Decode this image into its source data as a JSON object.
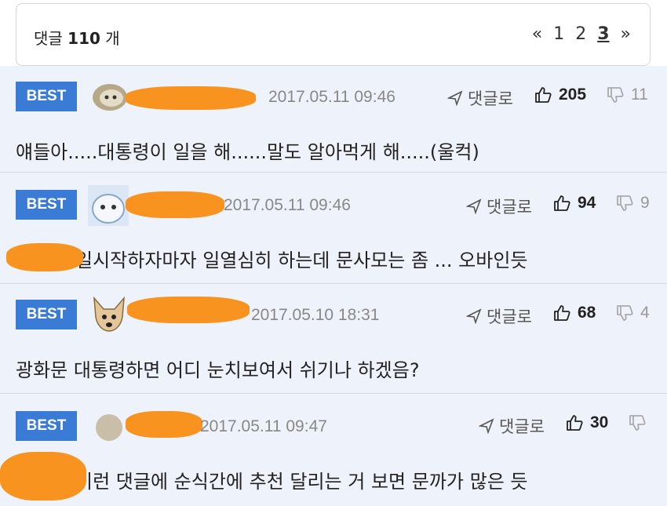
{
  "header": {
    "count_prefix": "댓글",
    "count_value": "110",
    "count_suffix": "개",
    "pager": {
      "prev": "«",
      "pages": [
        "1",
        "2",
        "3"
      ],
      "current": "3",
      "next": "»"
    }
  },
  "comments": [
    {
      "badge": "BEST",
      "date": "2017.05.11 09:46",
      "reply_label": "댓글로",
      "likes": "205",
      "dislikes": "11",
      "text": "얘들아.....대통령이 일을 해......말도 알아먹게 해.....(울컥)"
    },
    {
      "badge": "BEST",
      "date": "2017.05.11 09:46",
      "reply_label": "댓글로",
      "likes": "94",
      "dislikes": "9",
      "text": "일시작하자마자 일열심히 하는데 문사모는 좀 ... 오바인듯"
    },
    {
      "badge": "BEST",
      "date": "2017.05.10 18:31",
      "reply_label": "댓글로",
      "likes": "68",
      "dislikes": "4",
      "text": "광화문 대통령하면 어디 눈치보여서 쉬기나 하겠음?"
    },
    {
      "badge": "BEST",
      "date": "2017.05.11 09:47",
      "reply_label": "댓글로",
      "likes": "30",
      "dislikes": "",
      "text": "이런 댓글에 순식간에 추천 달리는 거 보면 문까가 많은 듯"
    }
  ],
  "colors": {
    "badge": "#3a7bd5",
    "redaction": "#f7931e",
    "row_background": "#eef2fb"
  }
}
